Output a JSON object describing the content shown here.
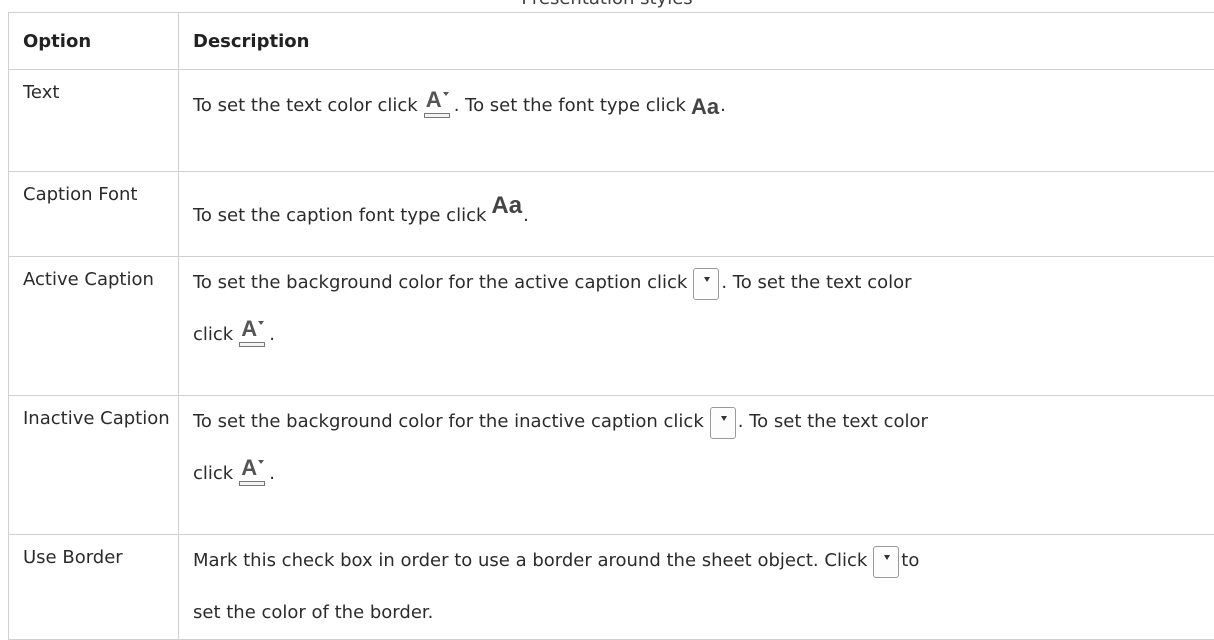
{
  "caption": "Presentation styles",
  "headers": {
    "option": "Option",
    "description": "Description"
  },
  "rows": [
    {
      "option": "Text",
      "d1": "To set the text color click",
      "d2": ". To set the font type click",
      "d3": "."
    },
    {
      "option": "Caption Font",
      "d1": "To set the caption font type click",
      "d2": "."
    },
    {
      "option": "Active Caption",
      "d1": "To set the background color for the active caption click",
      "d2": ". To set the text color",
      "d3": "click",
      "d4": "."
    },
    {
      "option": "Inactive Caption",
      "d1": "To set the background color for the inactive caption click",
      "d2": ". To set the text color",
      "d3": "click",
      "d4": "."
    },
    {
      "option": "Use Border",
      "d1": "Mark this check box in order to use a border around the sheet object. Click",
      "d2": "to",
      "d3": "set the color of the border."
    }
  ],
  "icons": {
    "font_color_glyph": "A",
    "font_type_glyph": "Aa"
  }
}
